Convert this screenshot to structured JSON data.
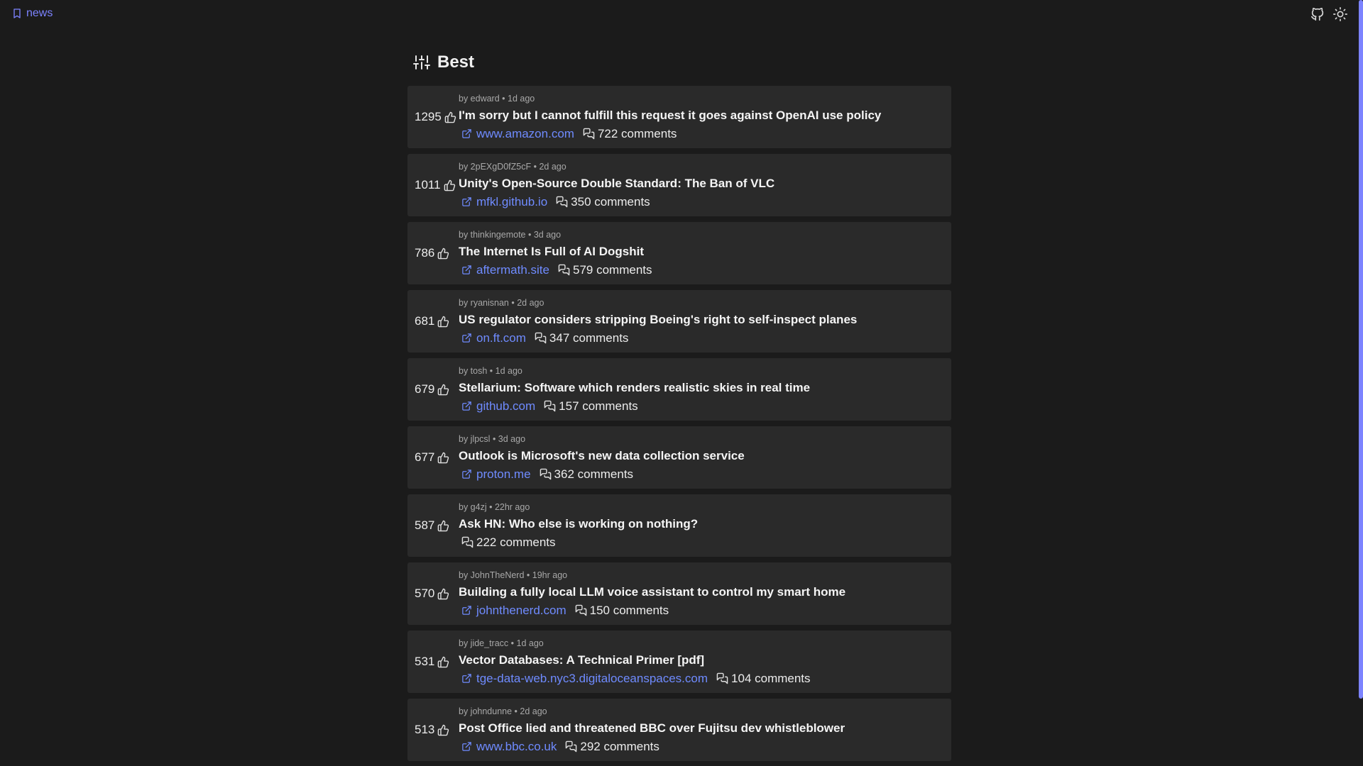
{
  "nav": {
    "brand_label": "news"
  },
  "header": {
    "title": "Best"
  },
  "colors": {
    "accent": "#7c83ff",
    "link": "#6f8bff",
    "card_bg": "#2a2a2a",
    "page_bg": "#1b1b1b"
  },
  "stories": [
    {
      "score": "1295",
      "by": "by edward",
      "age": "1d ago",
      "title": "I'm sorry but I cannot fulfill this request it goes against OpenAI use policy",
      "domain": "www.amazon.com",
      "comments": "722 comments"
    },
    {
      "score": "1011",
      "by": "by 2pEXgD0fZ5cF",
      "age": "2d ago",
      "title": "Unity's Open-Source Double Standard: The Ban of VLC",
      "domain": "mfkl.github.io",
      "comments": "350 comments"
    },
    {
      "score": "786",
      "by": "by thinkingemote",
      "age": "3d ago",
      "title": "The Internet Is Full of AI Dogshit",
      "domain": "aftermath.site",
      "comments": "579 comments"
    },
    {
      "score": "681",
      "by": "by ryanisnan",
      "age": "2d ago",
      "title": "US regulator considers stripping Boeing's right to self-inspect planes",
      "domain": "on.ft.com",
      "comments": "347 comments"
    },
    {
      "score": "679",
      "by": "by tosh",
      "age": "1d ago",
      "title": "Stellarium: Software which renders realistic skies in real time",
      "domain": "github.com",
      "comments": "157 comments"
    },
    {
      "score": "677",
      "by": "by jlpcsl",
      "age": "3d ago",
      "title": "Outlook is Microsoft's new data collection service",
      "domain": "proton.me",
      "comments": "362 comments"
    },
    {
      "score": "587",
      "by": "by g4zj",
      "age": "22hr ago",
      "title": "Ask HN: Who else is working on nothing?",
      "domain": "",
      "comments": "222 comments"
    },
    {
      "score": "570",
      "by": "by JohnTheNerd",
      "age": "19hr ago",
      "title": "Building a fully local LLM voice assistant to control my smart home",
      "domain": "johnthenerd.com",
      "comments": "150 comments"
    },
    {
      "score": "531",
      "by": "by jide_tracc",
      "age": "1d ago",
      "title": "Vector Databases: A Technical Primer [pdf]",
      "domain": "tge-data-web.nyc3.digitaloceanspaces.com",
      "comments": "104 comments"
    },
    {
      "score": "513",
      "by": "by johndunne",
      "age": "2d ago",
      "title": "Post Office lied and threatened BBC over Fujitsu dev whistleblower",
      "domain": "www.bbc.co.uk",
      "comments": "292 comments"
    }
  ]
}
